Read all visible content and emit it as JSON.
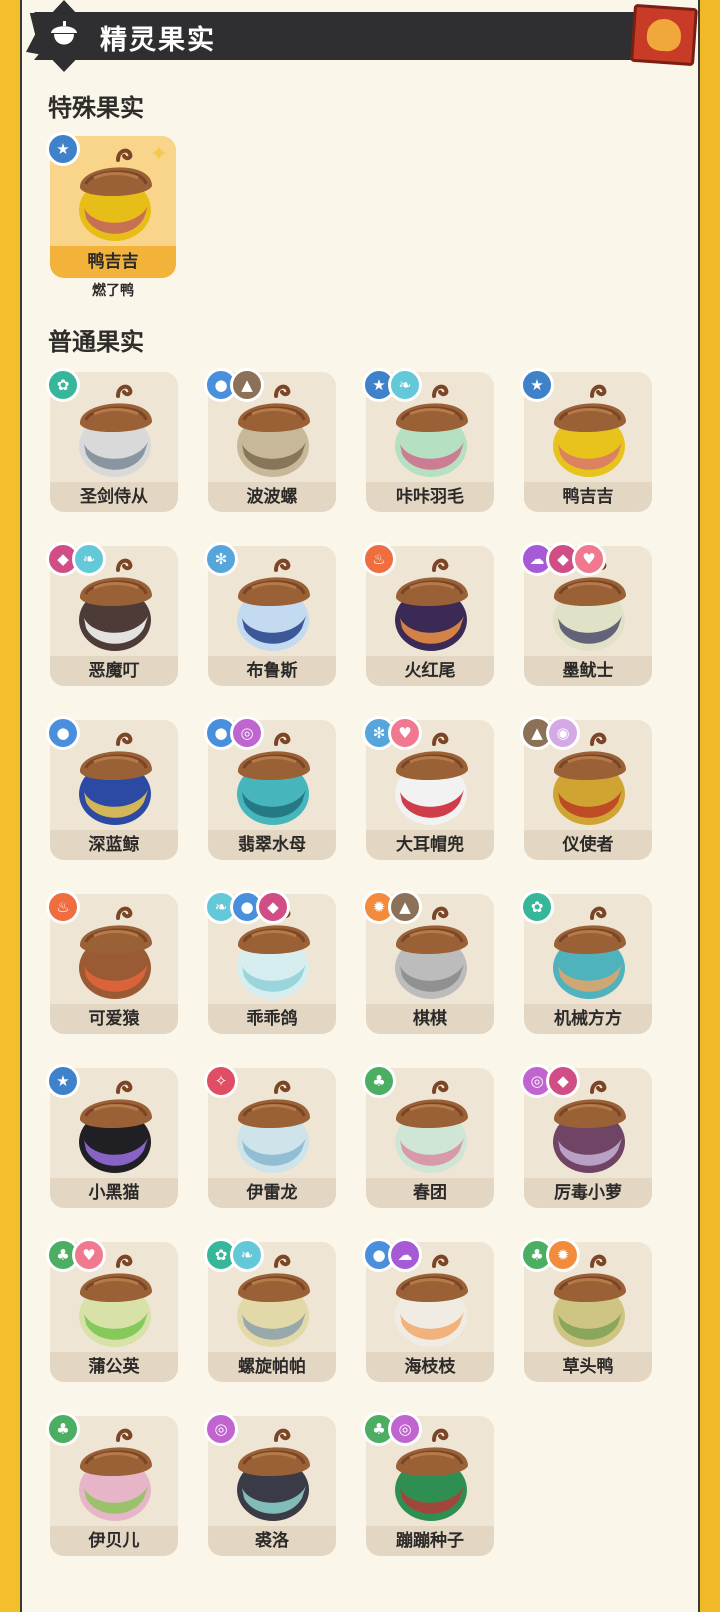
{
  "header": {
    "title": "精灵果实"
  },
  "special_section": {
    "title": "特殊果实",
    "card": {
      "label": "鸭吉吉",
      "sub": "燃了鸭",
      "types": [
        "star"
      ],
      "body": "#e7be17",
      "band": "#c0645f"
    }
  },
  "normal_section": {
    "title": "普通果实",
    "items": [
      {
        "label": "圣剑侍从",
        "types": [
          "gear"
        ],
        "body": "#d9d9d9",
        "band": "#7a8998"
      },
      {
        "label": "波波螺",
        "types": [
          "water",
          "mountain"
        ],
        "body": "#c8b89a",
        "band": "#7c6a4f"
      },
      {
        "label": "咔咔羽毛",
        "types": [
          "star",
          "wing"
        ],
        "body": "#b5e0c1",
        "band": "#d06a8b"
      },
      {
        "label": "鸭吉吉",
        "types": [
          "star"
        ],
        "body": "#e7c31c",
        "band": "#d8776c"
      },
      {
        "label": "恶魔叮",
        "types": [
          "demon",
          "wing"
        ],
        "body": "#4d3b37",
        "band": "#ffffff"
      },
      {
        "label": "布鲁斯",
        "types": [
          "ice"
        ],
        "body": "#c4daf0",
        "band": "#26418a"
      },
      {
        "label": "火红尾",
        "types": [
          "fire"
        ],
        "body": "#3b2a56",
        "band": "#f09342"
      },
      {
        "label": "墨鱿士",
        "types": [
          "ghost",
          "demon",
          "heart"
        ],
        "body": "#e0e1c7",
        "band": "#4e4b6a"
      },
      {
        "label": "深蓝鲸",
        "types": [
          "water"
        ],
        "body": "#2c4aa3",
        "band": "#f1c94a"
      },
      {
        "label": "翡翠水母",
        "types": [
          "water",
          "ring"
        ],
        "body": "#46b5bc",
        "band": "#1f6f7a"
      },
      {
        "label": "大耳帽兜",
        "types": [
          "ice",
          "heart"
        ],
        "body": "#f2f2f2",
        "band": "#c81d2b"
      },
      {
        "label": "仪使者",
        "types": [
          "mountain",
          "swirl"
        ],
        "body": "#d0a432",
        "band": "#bb3c22"
      },
      {
        "label": "可爱猿",
        "types": [
          "fire"
        ],
        "body": "#9a5a34",
        "band": "#e6653c"
      },
      {
        "label": "乖乖鸽",
        "types": [
          "wing",
          "water",
          "demon"
        ],
        "body": "#d6eef0",
        "band": "#8fd0d8"
      },
      {
        "label": "棋棋",
        "types": [
          "spark",
          "mountain"
        ],
        "body": "#bcbcbc",
        "band": "#8a8a8a"
      },
      {
        "label": "机械方方",
        "types": [
          "gear"
        ],
        "body": "#4fb3bd",
        "band": "#e3a56a"
      },
      {
        "label": "小黑猫",
        "types": [
          "star"
        ],
        "body": "#1f1f24",
        "band": "#9b6fe0"
      },
      {
        "label": "伊雷龙",
        "types": [
          "dragon"
        ],
        "body": "#cfe3ea",
        "band": "#86b7cf"
      },
      {
        "label": "春团",
        "types": [
          "leaf"
        ],
        "body": "#cfe6d7",
        "band": "#d98ca3"
      },
      {
        "label": "厉毒小萝",
        "types": [
          "ring",
          "demon"
        ],
        "body": "#6f4464",
        "band": "#c7b0d6"
      },
      {
        "label": "蒲公英",
        "types": [
          "leaf",
          "heart"
        ],
        "body": "#d8e2a8",
        "band": "#78c44e"
      },
      {
        "label": "螺旋帕帕",
        "types": [
          "gear",
          "wing"
        ],
        "body": "#e3d9a8",
        "band": "#8aa0ab"
      },
      {
        "label": "海枝枝",
        "types": [
          "water",
          "ghost"
        ],
        "body": "#f0ece4",
        "band": "#f1a86a"
      },
      {
        "label": "草头鸭",
        "types": [
          "leaf",
          "spark"
        ],
        "body": "#cfc582",
        "band": "#7ea053"
      },
      {
        "label": "伊贝儿",
        "types": [
          "leaf"
        ],
        "body": "#e6b6c8",
        "band": "#8bc45a"
      },
      {
        "label": "裘洛",
        "types": [
          "ring"
        ],
        "body": "#3a3b47",
        "band": "#8fd3ce"
      },
      {
        "label": "蹦蹦种子",
        "types": [
          "leaf",
          "ring"
        ],
        "body": "#2f8f52",
        "band": "#b53a3a"
      }
    ]
  },
  "type_colors": {
    "gear": "#36b79a",
    "water": "#4a8fdc",
    "mountain": "#8b7158",
    "star": "#3f82c9",
    "wing": "#63c9d8",
    "demon": "#d04e85",
    "ice": "#56a6dc",
    "fire": "#ef6d3e",
    "ghost": "#a65ad5",
    "heart": "#f0788f",
    "ring": "#c064cf",
    "swirl": "#d4a9e6",
    "spark": "#f28b3b",
    "dragon": "#e04e66",
    "leaf": "#4cae62"
  },
  "type_glyphs": {
    "gear": "✿",
    "water": "●",
    "mountain": "▲",
    "star": "★",
    "wing": "❧",
    "demon": "◆",
    "ice": "✻",
    "fire": "♨",
    "ghost": "☁",
    "heart": "♥",
    "ring": "◎",
    "swirl": "◉",
    "spark": "✹",
    "dragon": "✧",
    "leaf": "♣"
  }
}
